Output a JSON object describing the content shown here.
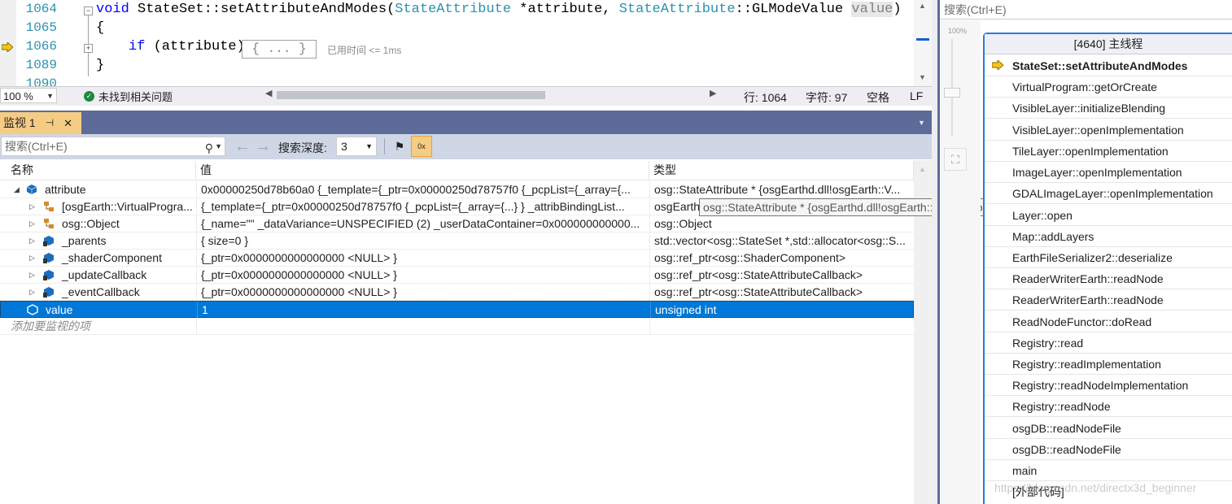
{
  "editor": {
    "lines": [
      {
        "num": "1064",
        "code_kw": "void",
        "code_rest": " StateSet::setAttributeAndModes(",
        "type1": "StateAttribute",
        "mid": " *attribute, ",
        "type2": "StateAttribute",
        "tail": "::GLModeValue ",
        "param": "value",
        "close": ")"
      },
      {
        "num": "1065",
        "code": "{"
      },
      {
        "num": "1066",
        "if_kw": "if",
        "if_rest": " (attribute)",
        "collapsed": "{ ... }",
        "elapsed": "已用时间 <= 1ms"
      },
      {
        "num": "1089",
        "code": "}"
      },
      {
        "num": "1090"
      }
    ]
  },
  "status": {
    "zoom": "100 %",
    "issues": "未找到相关问题",
    "line": "行: 1064",
    "char": "字符: 97",
    "spacing": "空格",
    "eol": "LF"
  },
  "watch": {
    "tab_title": "监视 1",
    "pin": "⊣",
    "close": "✕",
    "search_placeholder": "搜索(Ctrl+E)",
    "depth_label": "搜索深度:",
    "depth_value": "3",
    "columns": [
      "名称",
      "值",
      "类型"
    ],
    "rows": [
      {
        "name": "attribute",
        "value": "0x00000250d78b60a0 {_template={_ptr=0x00000250d78757f0 {_pcpList={_array={...",
        "type": "osg::StateAttribute * {osgEarthd.dll!osgEarth::V..."
      },
      {
        "name": "[osgEarth::VirtualProgra...",
        "value": "{_template={_ptr=0x00000250d78757f0 {_pcpList={_array={...} } _attribBindingList...",
        "type": "osgEarth"
      },
      {
        "name": "osg::Object",
        "value": "{_name=\"\" _dataVariance=UNSPECIFIED (2) _userDataContainer=0x000000000000...",
        "type": "osg::Object"
      },
      {
        "name": "_parents",
        "value": "{ size=0 }",
        "type": "std::vector<osg::StateSet *,std::allocator<osg::S..."
      },
      {
        "name": "_shaderComponent",
        "value": "{_ptr=0x0000000000000000 <NULL> }",
        "type": "osg::ref_ptr<osg::ShaderComponent>"
      },
      {
        "name": "_updateCallback",
        "value": "{_ptr=0x0000000000000000 <NULL> }",
        "type": "osg::ref_ptr<osg::StateAttributeCallback>"
      },
      {
        "name": "_eventCallback",
        "value": "{_ptr=0x0000000000000000 <NULL> }",
        "type": "osg::ref_ptr<osg::StateAttributeCallback>"
      },
      {
        "name": "value",
        "value": "1",
        "type": "unsigned int"
      },
      {
        "name": "添加要监视的项",
        "value": "",
        "type": ""
      }
    ],
    "tooltip": "osg::StateAttribute * {osgEarthd.dll!osgEarth::VirtualProgram}"
  },
  "callstack": {
    "search_placeholder": "搜索(Ctrl+E)",
    "zoom_label": "100%",
    "thread_header": "[4640] 主线程",
    "frames": [
      "StateSet::setAttributeAndModes",
      "VirtualProgram::getOrCreate",
      "VisibleLayer::initializeBlending",
      "VisibleLayer::openImplementation",
      "TileLayer::openImplementation",
      "ImageLayer::openImplementation",
      "GDALImageLayer::openImplementation",
      "Layer::open",
      "Map::addLayers",
      "EarthFileSerializer2::deserialize",
      "ReaderWriterEarth::readNode",
      "ReaderWriterEarth::readNode",
      "ReadNodeFunctor::doRead",
      "Registry::read",
      "Registry::readImplementation",
      "Registry::readNodeImplementation",
      "Registry::readNode",
      "osgDB::readNodeFile",
      "osgDB::readNodeFile",
      "main",
      "[外部代码]"
    ],
    "watermark": "https://blog.csdn.net/directx3d_beginner"
  },
  "colors": {
    "accent": "#0078d7",
    "tab_active": "#f5cc84",
    "toolwindow_title": "#5d6b99",
    "line_number": "#2b91af",
    "keyword": "#0000ff"
  }
}
